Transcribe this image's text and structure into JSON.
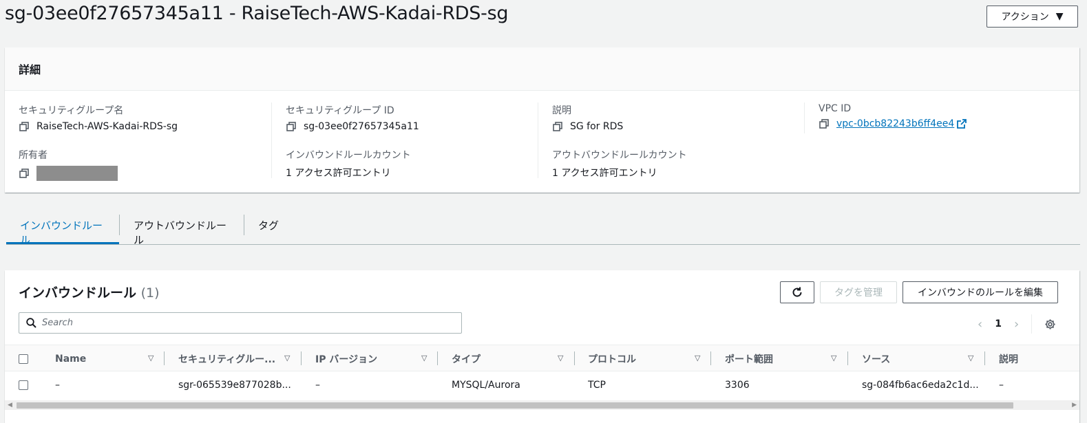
{
  "page": {
    "title": "sg-03ee0f27657345a11 - RaiseTech-AWS-Kadai-RDS-sg",
    "actions_label": "アクション"
  },
  "details": {
    "header": "詳細",
    "sg_name_label": "セキュリティグループ名",
    "sg_name_value": "RaiseTech-AWS-Kadai-RDS-sg",
    "sg_id_label": "セキュリティグループ ID",
    "sg_id_value": "sg-03ee0f27657345a11",
    "description_label": "説明",
    "description_value": "SG for RDS",
    "vpc_label": "VPC ID",
    "vpc_value": "vpc-0bcb82243b6ff4ee4",
    "owner_label": "所有者",
    "inbound_count_label": "インバウンドルールカウント",
    "inbound_count_value": "1 アクセス許可エントリ",
    "outbound_count_label": "アウトバウンドルールカウント",
    "outbound_count_value": "1 アクセス許可エントリ"
  },
  "tabs": [
    {
      "label": "インバウンドルール",
      "active": true
    },
    {
      "label": "アウトバウンドルール",
      "active": false
    },
    {
      "label": "タグ",
      "active": false
    }
  ],
  "rules": {
    "title": "インバウンドルール",
    "count": "(1)",
    "manage_tags_label": "タグを管理",
    "edit_label": "インバウンドのルールを編集",
    "search_placeholder": "Search",
    "page_number": "1",
    "columns": [
      "Name",
      "セキュリティグルー...",
      "IP バージョン",
      "タイプ",
      "プロトコル",
      "ポート範囲",
      "ソース",
      "説明"
    ],
    "rows": [
      [
        "–",
        "sgr-065539e877028b...",
        "–",
        "MYSQL/Aurora",
        "TCP",
        "3306",
        "sg-084fb6ac6eda2c1d...",
        "–"
      ]
    ]
  },
  "colors": {
    "link": "#0073bb",
    "text": "#16191f",
    "label": "#545b64",
    "background": "#f2f3f3"
  },
  "icons": [
    "copy-icon",
    "external-link-icon",
    "refresh-icon",
    "search-icon",
    "settings-icon",
    "caret-down-icon"
  ]
}
